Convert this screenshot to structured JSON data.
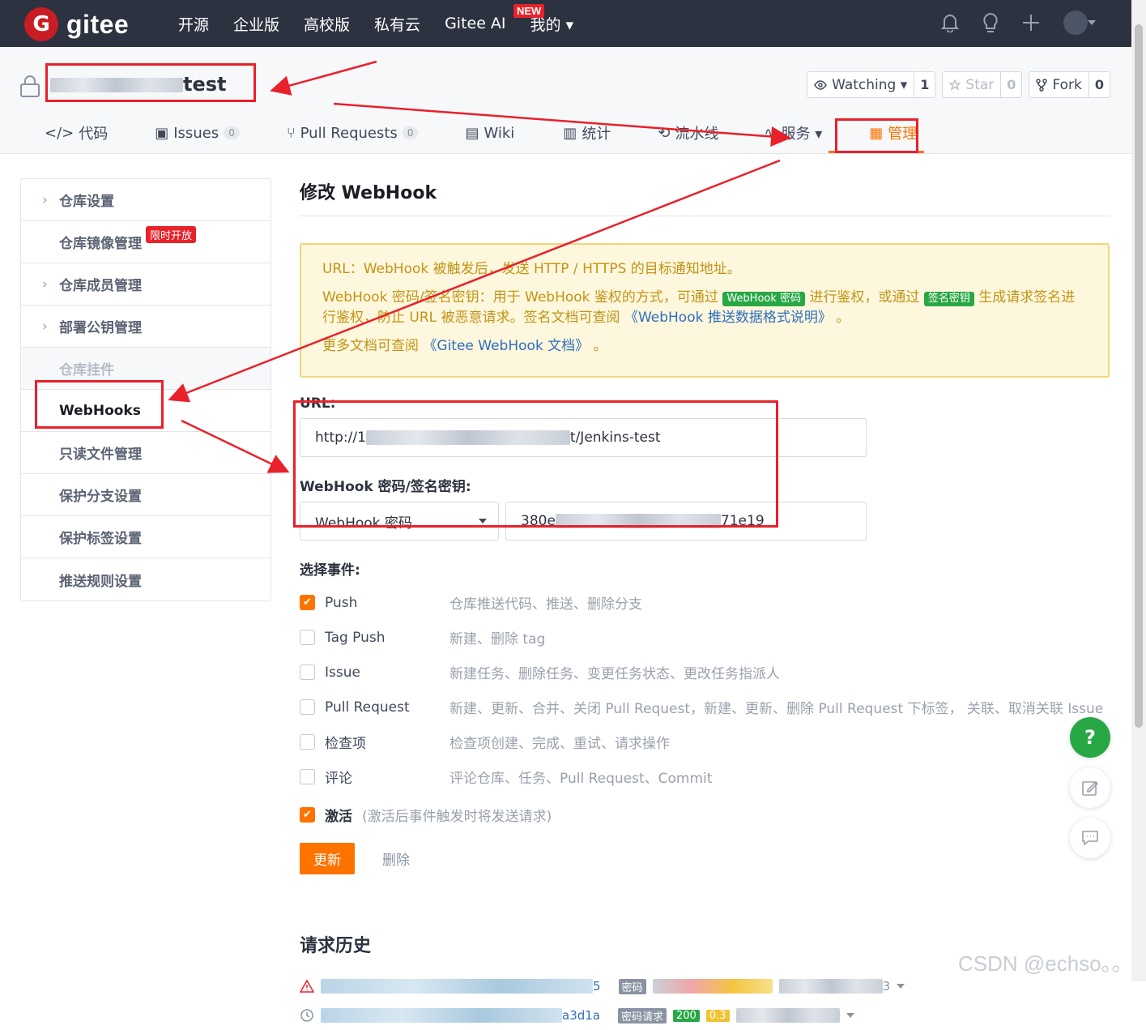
{
  "nav": {
    "logo_letter": "G",
    "logo_text": "gitee",
    "items": [
      "开源",
      "企业版",
      "高校版",
      "私有云",
      "Gitee AI",
      "我的 ▾"
    ],
    "new_badge": "NEW"
  },
  "repo": {
    "name_suffix": "test",
    "watching": {
      "label": "Watching ▾",
      "count": "1"
    },
    "star": {
      "label": "Star",
      "count": "0"
    },
    "fork": {
      "label": "Fork",
      "count": "0"
    },
    "tabs": [
      {
        "label": "代码"
      },
      {
        "label": "Issues",
        "count": "0"
      },
      {
        "label": "Pull Requests",
        "count": "0"
      },
      {
        "label": "Wiki"
      },
      {
        "label": "统计"
      },
      {
        "label": "流水线"
      },
      {
        "label": "服务 ▾"
      },
      {
        "label": "管理"
      }
    ]
  },
  "sidebar": {
    "items": [
      "仓库设置",
      "仓库镜像管理",
      "仓库成员管理",
      "部署公钥管理",
      "仓库挂件",
      "WebHooks",
      "只读文件管理",
      "保护分支设置",
      "保护标签设置",
      "推送规则设置"
    ],
    "limited_tag": "限时开放"
  },
  "main": {
    "title": "修改 WebHook",
    "notice": {
      "line1": "URL：WebHook 被触发后，发送 HTTP / HTTPS 的目标通知地址。",
      "line2_a": "WebHook 密码/签名密钥：用于 WebHook 鉴权的方式，可通过",
      "badge_password": "WebHook 密码",
      "line2_b": "进行鉴权，或通过",
      "badge_sign": "签名密钥",
      "line2_c": "生成请求签名进行鉴权，防止 URL 被恶意请求。签名文档可查阅",
      "link1": "《WebHook 推送数据格式说明》",
      "line2_d": "。",
      "line3_a": "更多文档可查阅",
      "link2": "《Gitee WebHook 文档》",
      "line3_b": "。"
    },
    "url_label": "URL:",
    "url_prefix": "http://1",
    "url_suffix": "t/Jenkins-test",
    "secret_label": "WebHook 密码/签名密钥:",
    "secret_type": "WebHook 密码",
    "secret_prefix": "380e",
    "secret_suffix": "71e19",
    "events_label": "选择事件:",
    "events": [
      {
        "name": "Push",
        "desc": "仓库推送代码、推送、删除分支",
        "checked": true
      },
      {
        "name": "Tag Push",
        "desc": "新建、删除 tag",
        "checked": false
      },
      {
        "name": "Issue",
        "desc": "新建任务、删除任务、变更任务状态、更改任务指派人",
        "checked": false
      },
      {
        "name": "Pull Request",
        "desc": "新建、更新、合并、关闭 Pull Request，新建、更新、删除 Pull Request 下标签， 关联、取消关联 Issue",
        "checked": false
      },
      {
        "name": "检查项",
        "desc": "检查项创建、完成、重试、请求操作",
        "checked": false
      },
      {
        "name": "评论",
        "desc": "评论仓库、任务、Pull Request、Commit",
        "checked": false
      }
    ],
    "active_label": "激活",
    "active_hint": "(激活后事件触发时将发送请求)",
    "update_btn": "更新",
    "delete_btn": "删除",
    "history_title": "请求历史",
    "history": [
      {
        "suffix": "5",
        "tag": "密码",
        "end": "3"
      },
      {
        "suffix": "a3d1a",
        "tag": "密码请求",
        "status": "200",
        "time": "0.3"
      }
    ]
  },
  "float": {
    "help": "?"
  },
  "watermark": "CSDN @echso。。"
}
